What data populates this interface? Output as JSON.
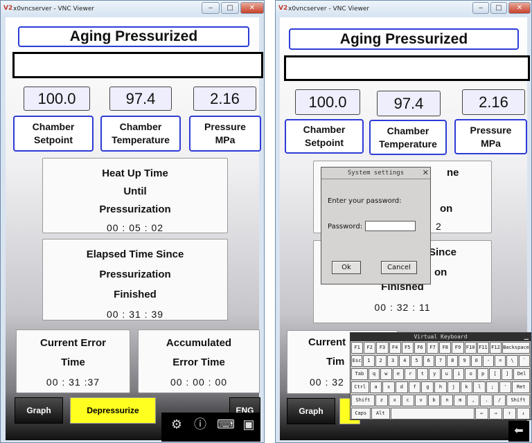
{
  "window_title": "x0vncserver - VNC Viewer",
  "title_icon": "V2",
  "window_controls": [
    "‒",
    "□",
    "✕"
  ],
  "screen_title": "Aging Pressurized",
  "readouts": [
    {
      "left": {
        "value": "100.0",
        "label1": "Chamber",
        "label2": "Setpoint"
      },
      "mid": {
        "value": "97.4",
        "label1": "Chamber",
        "label2": "Temperature"
      },
      "right": {
        "value": "2.16",
        "label1": "Pressure",
        "label2": "MPa"
      }
    }
  ],
  "left": {
    "values": {
      "setpoint": "100.0",
      "temperature": "97.4",
      "pressure": "2.16"
    },
    "labels": {
      "setpoint_1": "Chamber",
      "setpoint_2": "Setpoint",
      "temp_1": "Chamber",
      "temp_2": "Temperature",
      "pressure_1": "Pressure",
      "pressure_2": "MPa"
    },
    "heatup": {
      "line1": "Heat Up Time",
      "line2": "Until",
      "line3": "Pressurization",
      "time": "00 : 05 : 02"
    },
    "elapsed": {
      "line1": "Elapsed Time Since",
      "line2": "Pressurization",
      "line3": "Finished",
      "time": "00 : 31 : 39"
    },
    "current_error": {
      "line1": "Current Error",
      "line2": "Time",
      "time": "00 : 31 :37"
    },
    "accum_error": {
      "line1": "Accumulated",
      "line2": "Error Time",
      "time": "00 : 00 : 00"
    },
    "buttons": {
      "graph": "Graph",
      "depressurize": "Depressurize",
      "lang": "ENG"
    }
  },
  "right": {
    "values": {
      "setpoint": "100.0",
      "temperature": "97.4",
      "pressure": "2.16"
    },
    "labels": {
      "setpoint_1": "Chamber",
      "setpoint_2": "Setpoint",
      "temp_1": "Chamber",
      "temp_2": "Temperature",
      "pressure_1": "Pressure",
      "pressure_2": "MPa"
    },
    "heatup_partial": {
      "line1": "ne",
      "line3": "on",
      "time": "2"
    },
    "elapsed": {
      "line1": "Since",
      "line2": "on",
      "line3": "Finished",
      "time": "00 : 32 : 11"
    },
    "current_error": {
      "line1": "Current",
      "line2": "Tim",
      "time": "00 : 32"
    },
    "buttons": {
      "graph": "Graph"
    },
    "dialog": {
      "title": "System settings",
      "prompt": "Enter your password:",
      "field_label": "Password:",
      "password_value": "",
      "ok": "Ok",
      "cancel": "Cancel"
    },
    "keyboard": {
      "title": "Virtual Keyboard",
      "rows": [
        [
          "F1",
          "F2",
          "F3",
          "F4",
          "F5",
          "F6",
          "F7",
          "F8",
          "F9",
          "F10",
          "F11",
          "F12",
          "Backspace"
        ],
        [
          "Esc",
          "1",
          "2",
          "3",
          "4",
          "5",
          "6",
          "7",
          "8",
          "9",
          "0",
          "-",
          "=",
          "\\",
          "`"
        ],
        [
          "Tab",
          "q",
          "w",
          "e",
          "r",
          "t",
          "y",
          "u",
          "i",
          "o",
          "p",
          "[",
          "]",
          "Del"
        ],
        [
          "Ctrl",
          "a",
          "s",
          "d",
          "f",
          "g",
          "h",
          "j",
          "k",
          "l",
          ";",
          "'",
          "Ret"
        ],
        [
          "Shift",
          "z",
          "x",
          "c",
          "v",
          "b",
          "n",
          "m",
          ",",
          ".",
          "/",
          "Shift"
        ],
        [
          "Caps",
          "Alt",
          " ",
          "←",
          "→",
          "↑",
          "↓"
        ]
      ]
    }
  },
  "toolbar_icons": [
    "gear-icon",
    "info-icon",
    "keyboard-icon",
    "save-icon"
  ],
  "colors": {
    "title_border": "#2c3bd6",
    "depressurize_bg": "#ffff20",
    "value_bg": "#eeeefc"
  }
}
